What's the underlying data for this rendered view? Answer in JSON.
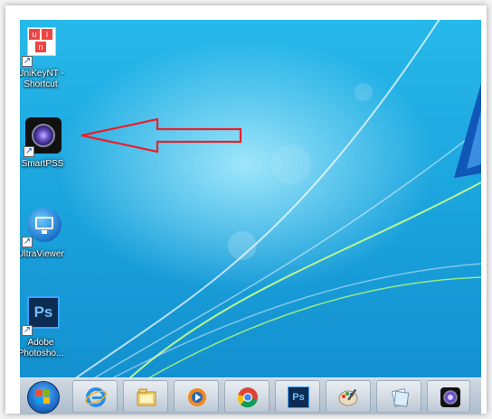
{
  "desktop": {
    "icons": [
      {
        "label_line1": "UniKeyNT -",
        "label_line2": "Shortcut"
      },
      {
        "label_line1": "SmartPSS",
        "label_line2": ""
      },
      {
        "label_line1": "UltraViewer",
        "label_line2": ""
      },
      {
        "label_line1": "Adobe",
        "label_line2": "Photosho..."
      }
    ],
    "unikey_letters": [
      "u",
      "i",
      "n"
    ],
    "ps_text": "Ps"
  },
  "taskbar": {
    "ps_label": "Ps",
    "items": [
      "start-button",
      "ie-icon",
      "explorer-icon",
      "media-player-icon",
      "chrome-icon",
      "photoshop-icon",
      "paint-icon",
      "document-icon",
      "smartpss-icon"
    ]
  },
  "colors": {
    "desktop_top": "#27b8ea",
    "desktop_bottom": "#1390cf",
    "arrow": "#e8202a",
    "taskbar": "#c5d0dc"
  }
}
